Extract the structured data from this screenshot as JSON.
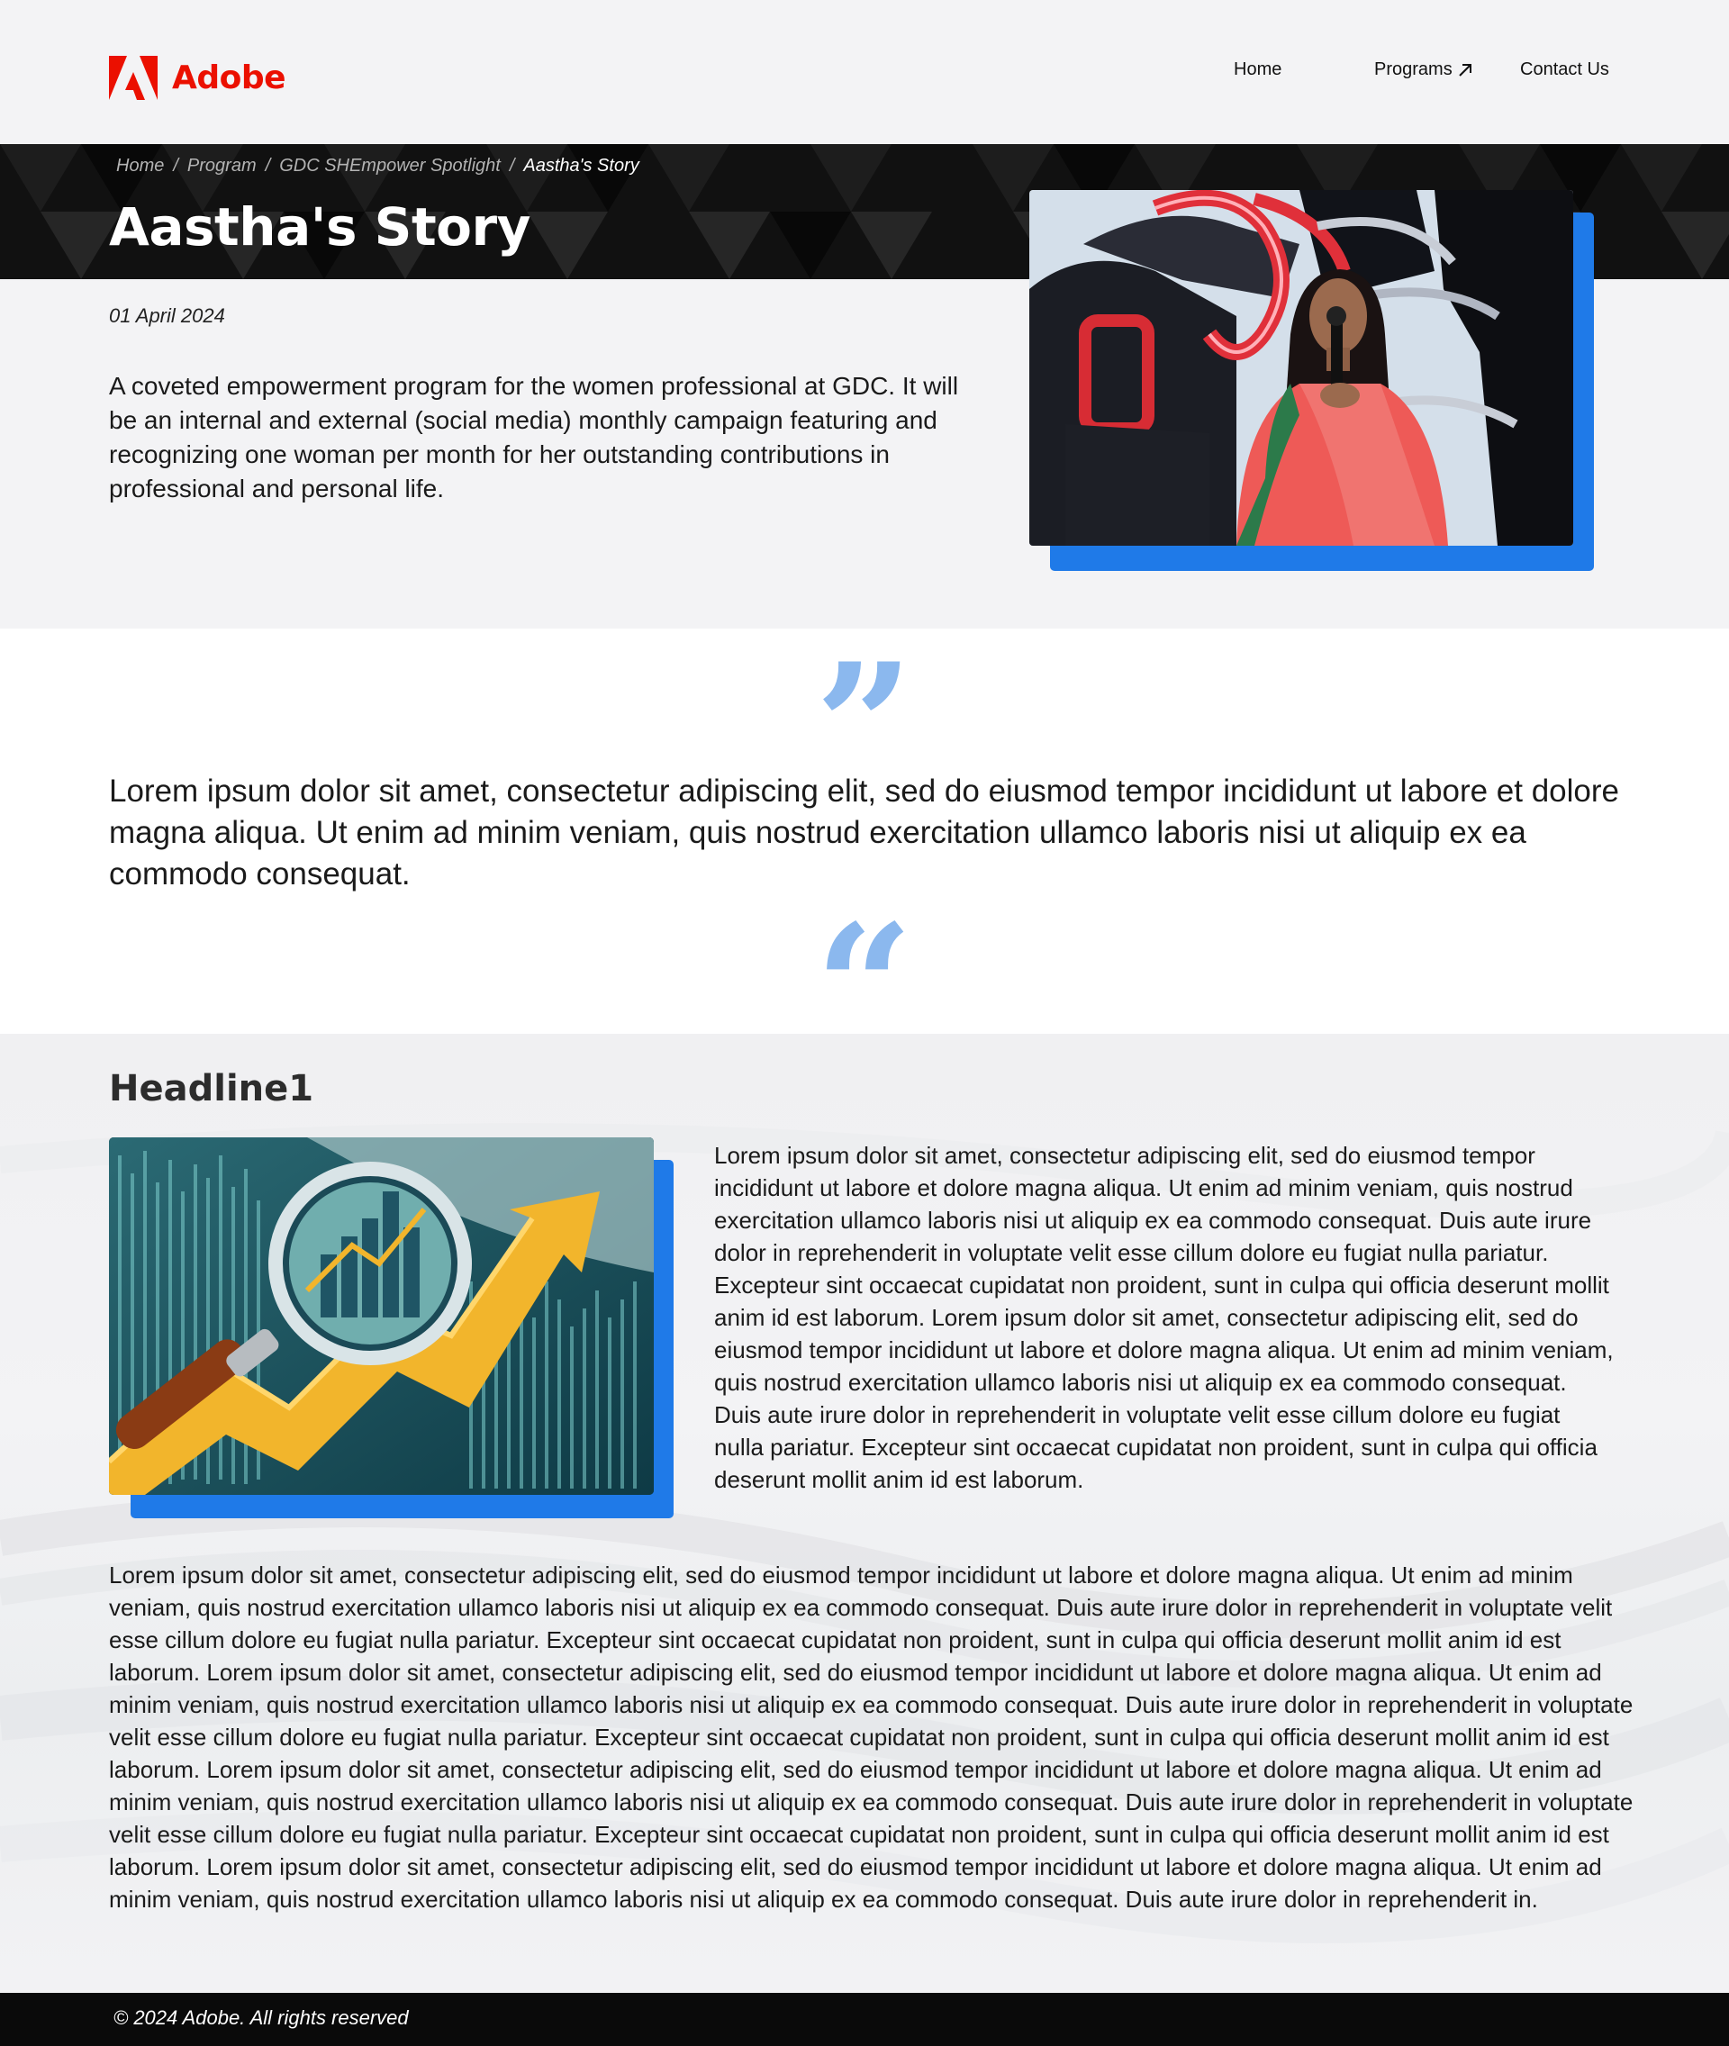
{
  "header": {
    "brand": "Adobe",
    "nav": {
      "home": "Home",
      "programs": "Programs",
      "contact": "Contact Us"
    },
    "brand_color": "#eb1000"
  },
  "breadcrumb": {
    "items": [
      "Home",
      "Program",
      "GDC SHEmpower Spotlight",
      "Aastha's Story"
    ],
    "separator": "/"
  },
  "hero": {
    "title": "Aastha's Story",
    "date": "01 April 2024",
    "intro": "A coveted empowerment program for the women professional at GDC. It will be an internal and external (social media) monthly campaign featuring and recognizing one woman per month for her outstanding contributions in professional and personal life.",
    "accent_color": "#1f7ae8"
  },
  "quote": {
    "text": "Lorem ipsum dolor sit amet, consectetur adipiscing elit, sed do eiusmod tempor incididunt ut labore et dolore magna aliqua. Ut enim ad minim veniam, quis nostrud exercitation ullamco laboris nisi ut aliquip ex ea commodo consequat.",
    "close_mark": "”",
    "open_mark": "“",
    "mark_color": "#8bb8ee"
  },
  "article": {
    "headline": "Headline1",
    "side_text": "Lorem ipsum dolor sit amet, consectetur adipiscing elit, sed do eiusmod tempor incididunt ut labore et dolore magna aliqua. Ut enim ad minim veniam, quis nostrud exercitation ullamco laboris nisi ut aliquip ex ea commodo consequat. Duis aute irure dolor in reprehenderit in voluptate velit esse cillum dolore eu fugiat nulla pariatur. Excepteur sint occaecat cupidatat non proident, sunt in culpa qui officia deserunt mollit anim id est laborum. Lorem ipsum dolor sit amet, consectetur adipiscing elit, sed do eiusmod tempor incididunt ut labore et dolore magna aliqua. Ut enim ad minim veniam, quis nostrud exercitation ullamco laboris nisi ut aliquip ex ea commodo consequat. Duis aute irure dolor in reprehenderit in voluptate velit esse cillum dolore eu fugiat nulla pariatur. Excepteur sint occaecat cupidatat non proident, sunt in culpa qui officia deserunt mollit anim id est laborum.",
    "body_text": "Lorem ipsum dolor sit amet, consectetur adipiscing elit, sed do eiusmod tempor incididunt ut labore et dolore magna aliqua. Ut enim ad minim veniam, quis nostrud exercitation ullamco laboris nisi ut aliquip ex ea commodo consequat. Duis aute irure dolor in reprehenderit in voluptate velit esse cillum dolore eu fugiat nulla pariatur. Excepteur sint occaecat cupidatat non proident, sunt in culpa qui officia deserunt mollit anim id est laborum. Lorem ipsum dolor sit amet, consectetur adipiscing elit, sed do eiusmod tempor incididunt ut labore et dolore magna aliqua. Ut enim ad minim veniam, quis nostrud exercitation ullamco laboris nisi ut aliquip ex ea commodo consequat. Duis aute irure dolor in reprehenderit in voluptate velit esse cillum dolore eu fugiat nulla pariatur. Excepteur sint occaecat cupidatat non proident, sunt in culpa qui officia deserunt mollit anim id est laborum. Lorem ipsum dolor sit amet, consectetur adipiscing elit, sed do eiusmod tempor incididunt ut labore et dolore magna aliqua. Ut enim ad minim veniam, quis nostrud exercitation ullamco laboris nisi ut aliquip ex ea commodo consequat. Duis aute irure dolor in reprehenderit in voluptate velit esse cillum dolore eu fugiat nulla pariatur. Excepteur sint occaecat cupidatat non proident, sunt in culpa qui officia deserunt mollit anim id est laborum. Lorem ipsum dolor sit amet, consectetur adipiscing elit, sed do eiusmod tempor incididunt ut labore et dolore magna aliqua. Ut enim ad minim veniam, quis nostrud exercitation ullamco laboris nisi ut aliquip ex ea commodo consequat. Duis aute irure dolor in reprehenderit in."
  },
  "footer": {
    "copyright": "© 2024 Adobe. All rights reserved"
  },
  "icons": {
    "logo": "adobe-logo-icon",
    "programs_arrow": "arrow-up-right-icon"
  }
}
